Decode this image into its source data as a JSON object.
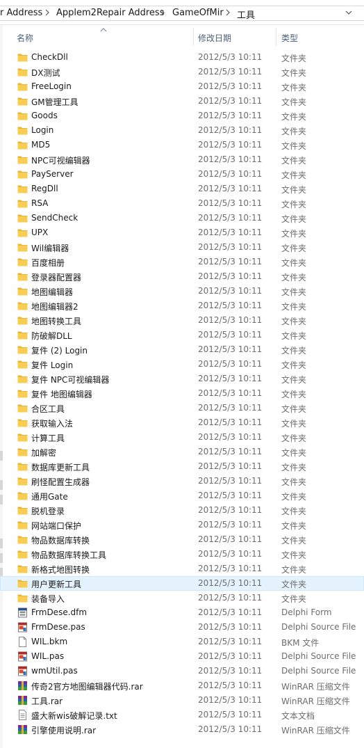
{
  "breadcrumb": {
    "items": [
      "r Address",
      "Applem2Repair Address",
      "GameOfMir",
      "工具"
    ]
  },
  "columns": {
    "name": "名称",
    "date": "修改日期",
    "type": "类型"
  },
  "colors": {
    "folder": "#f7cd53",
    "folder_dark": "#e8b53a",
    "header_text": "#4c607a",
    "selected_bg": "#e5f3ff"
  },
  "files": [
    {
      "name": "CheckDll",
      "date": "2012/5/3 10:11",
      "type": "文件夹",
      "icon": "folder-icon"
    },
    {
      "name": "DX测试",
      "date": "2012/5/3 10:11",
      "type": "文件夹",
      "icon": "folder-icon"
    },
    {
      "name": "FreeLogin",
      "date": "2012/5/3 10:11",
      "type": "文件夹",
      "icon": "folder-icon"
    },
    {
      "name": "GM管理工具",
      "date": "2012/5/3 10:11",
      "type": "文件夹",
      "icon": "folder-icon"
    },
    {
      "name": "Goods",
      "date": "2012/5/3 10:11",
      "type": "文件夹",
      "icon": "folder-icon"
    },
    {
      "name": "Login",
      "date": "2012/5/3 10:11",
      "type": "文件夹",
      "icon": "folder-icon"
    },
    {
      "name": "MD5",
      "date": "2012/5/3 10:11",
      "type": "文件夹",
      "icon": "folder-icon"
    },
    {
      "name": "NPC可视编辑器",
      "date": "2012/5/3 10:11",
      "type": "文件夹",
      "icon": "folder-icon"
    },
    {
      "name": "PayServer",
      "date": "2012/5/3 10:11",
      "type": "文件夹",
      "icon": "folder-icon"
    },
    {
      "name": "RegDll",
      "date": "2012/5/3 10:11",
      "type": "文件夹",
      "icon": "folder-icon"
    },
    {
      "name": "RSA",
      "date": "2012/5/3 10:11",
      "type": "文件夹",
      "icon": "folder-icon"
    },
    {
      "name": "SendCheck",
      "date": "2012/5/3 10:11",
      "type": "文件夹",
      "icon": "folder-icon"
    },
    {
      "name": "UPX",
      "date": "2012/5/3 10:11",
      "type": "文件夹",
      "icon": "folder-icon"
    },
    {
      "name": "Wil编辑器",
      "date": "2012/5/3 10:11",
      "type": "文件夹",
      "icon": "folder-icon"
    },
    {
      "name": "百度相册",
      "date": "2012/5/3 10:11",
      "type": "文件夹",
      "icon": "folder-icon"
    },
    {
      "name": "登录器配置器",
      "date": "2012/5/3 10:11",
      "type": "文件夹",
      "icon": "folder-icon"
    },
    {
      "name": "地图编辑器",
      "date": "2012/5/3 10:11",
      "type": "文件夹",
      "icon": "folder-icon"
    },
    {
      "name": "地图编辑器2",
      "date": "2012/5/3 10:11",
      "type": "文件夹",
      "icon": "folder-icon"
    },
    {
      "name": "地图转换工具",
      "date": "2012/5/3 10:11",
      "type": "文件夹",
      "icon": "folder-icon"
    },
    {
      "name": "防破解DLL",
      "date": "2012/5/3 10:11",
      "type": "文件夹",
      "icon": "folder-icon"
    },
    {
      "name": "复件 (2) Login",
      "date": "2012/5/3 10:11",
      "type": "文件夹",
      "icon": "folder-icon"
    },
    {
      "name": "复件 Login",
      "date": "2012/5/3 10:11",
      "type": "文件夹",
      "icon": "folder-icon"
    },
    {
      "name": "复件 NPC可视编辑器",
      "date": "2012/5/3 10:11",
      "type": "文件夹",
      "icon": "folder-icon"
    },
    {
      "name": "复件 地图编辑器",
      "date": "2012/5/3 10:11",
      "type": "文件夹",
      "icon": "folder-icon"
    },
    {
      "name": "合区工具",
      "date": "2012/5/3 10:11",
      "type": "文件夹",
      "icon": "folder-icon"
    },
    {
      "name": "获取输入法",
      "date": "2012/5/3 10:11",
      "type": "文件夹",
      "icon": "folder-icon"
    },
    {
      "name": "计算工具",
      "date": "2012/5/3 10:11",
      "type": "文件夹",
      "icon": "folder-icon"
    },
    {
      "name": "加解密",
      "date": "2012/5/3 10:11",
      "type": "文件夹",
      "icon": "folder-icon"
    },
    {
      "name": "数据库更新工具",
      "date": "2012/5/3 10:11",
      "type": "文件夹",
      "icon": "folder-icon"
    },
    {
      "name": "刷怪配置生成器",
      "date": "2012/5/3 10:11",
      "type": "文件夹",
      "icon": "folder-icon"
    },
    {
      "name": "通用Gate",
      "date": "2012/5/3 10:11",
      "type": "文件夹",
      "icon": "folder-icon"
    },
    {
      "name": "脱机登录",
      "date": "2012/5/3 10:11",
      "type": "文件夹",
      "icon": "folder-icon"
    },
    {
      "name": "网站端口保护",
      "date": "2012/5/3 10:11",
      "type": "文件夹",
      "icon": "folder-icon"
    },
    {
      "name": "物品数据库转换",
      "date": "2012/5/3 10:11",
      "type": "文件夹",
      "icon": "folder-icon"
    },
    {
      "name": "物品数据库转换工具",
      "date": "2012/5/3 10:11",
      "type": "文件夹",
      "icon": "folder-icon"
    },
    {
      "name": "新格式地图转换",
      "date": "2012/5/3 10:11",
      "type": "文件夹",
      "icon": "folder-icon"
    },
    {
      "name": "用户更新工具",
      "date": "2012/5/3 10:11",
      "type": "文件夹",
      "icon": "folder-icon",
      "selected": true
    },
    {
      "name": "装备导入",
      "date": "2012/5/3 10:11",
      "type": "文件夹",
      "icon": "folder-icon"
    },
    {
      "name": "FrmDese.dfm",
      "date": "2012/5/3 10:11",
      "type": "Delphi Form",
      "icon": "delphi-form-icon"
    },
    {
      "name": "FrmDese.pas",
      "date": "2012/5/3 10:11",
      "type": "Delphi Source File",
      "icon": "delphi-source-icon"
    },
    {
      "name": "WIL.bkm",
      "date": "2012/5/3 10:11",
      "type": "BKM 文件",
      "icon": "blank-file-icon"
    },
    {
      "name": "WIL.pas",
      "date": "2012/5/3 10:11",
      "type": "Delphi Source File",
      "icon": "delphi-source-icon"
    },
    {
      "name": "wmUtil.pas",
      "date": "2012/5/3 10:11",
      "type": "Delphi Source File",
      "icon": "delphi-source-icon"
    },
    {
      "name": "传奇2官方地图编辑器代码.rar",
      "date": "2012/5/3 10:11",
      "type": "WinRAR 压缩文件",
      "icon": "winrar-icon"
    },
    {
      "name": "工具.rar",
      "date": "2012/5/3 10:11",
      "type": "WinRAR 压缩文件",
      "icon": "winrar-icon"
    },
    {
      "name": "盛大新wis破解记录.txt",
      "date": "2012/5/3 10:11",
      "type": "文本文档",
      "icon": "text-file-icon"
    },
    {
      "name": "引擎使用说明.rar",
      "date": "2012/5/3 10:11",
      "type": "WinRAR 压缩文件",
      "icon": "winrar-icon"
    }
  ]
}
